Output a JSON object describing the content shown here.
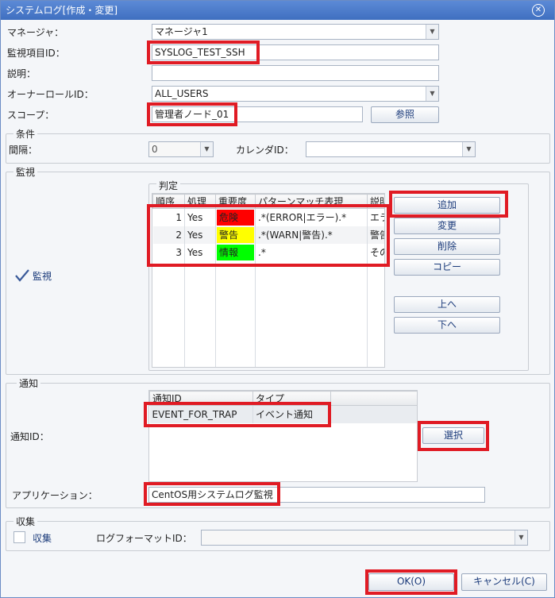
{
  "title": "システムログ[作成・変更]",
  "fields": {
    "manager_label": "マネージャ：",
    "manager_value": "マネージャ1",
    "monitor_id_label": "監視項目ID：",
    "monitor_id_value": "SYSLOG_TEST_SSH",
    "description_label": "説明：",
    "description_value": "",
    "owner_role_label": "オーナーロールID：",
    "owner_role_value": "ALL_USERS",
    "scope_label": "スコープ：",
    "scope_value": "管理者ノード_01",
    "scope_button": "参照"
  },
  "condition": {
    "title": "条件",
    "interval_label": "間隔：",
    "interval_value": "0",
    "calendar_label": "カレンダID：",
    "calendar_value": ""
  },
  "monitor": {
    "title": "監視",
    "checkbox_label": "監視",
    "checked": true,
    "judgement_title": "判定",
    "columns": [
      "順序",
      "処理",
      "重要度",
      "パターンマッチ表現",
      "説明"
    ],
    "rows": [
      {
        "order": "1",
        "process": "Yes",
        "severity": "危険",
        "severity_color": "#ff0000",
        "pattern": ".*(ERROR|エラー).*",
        "desc": "エラ"
      },
      {
        "order": "2",
        "process": "Yes",
        "severity": "警告",
        "severity_color": "#ffff00",
        "pattern": ".*(WARN|警告).*",
        "desc": "警告"
      },
      {
        "order": "3",
        "process": "Yes",
        "severity": "情報",
        "severity_color": "#00ff00",
        "pattern": ".*",
        "desc": "その"
      }
    ],
    "buttons": {
      "add": "追加",
      "change": "変更",
      "delete": "削除",
      "copy": "コピー",
      "up": "上へ",
      "down": "下へ"
    }
  },
  "notification": {
    "title": "通知",
    "id_label": "通知ID：",
    "columns": [
      "通知ID",
      "タイプ"
    ],
    "rows": [
      {
        "id": "EVENT_FOR_TRAP",
        "type": "イベント通知"
      }
    ],
    "select_button": "選択",
    "application_label": "アプリケーション：",
    "application_value": "CentOS用システムログ監視"
  },
  "collection": {
    "title": "収集",
    "checkbox_label": "収集",
    "checked": false,
    "log_format_label": "ログフォーマットID：",
    "log_format_value": ""
  },
  "footer": {
    "ok": "OK(O)",
    "cancel": "キャンセル(C)"
  },
  "colors": {
    "highlight": "#e01b24",
    "titlebar": "#4a7bcf"
  }
}
